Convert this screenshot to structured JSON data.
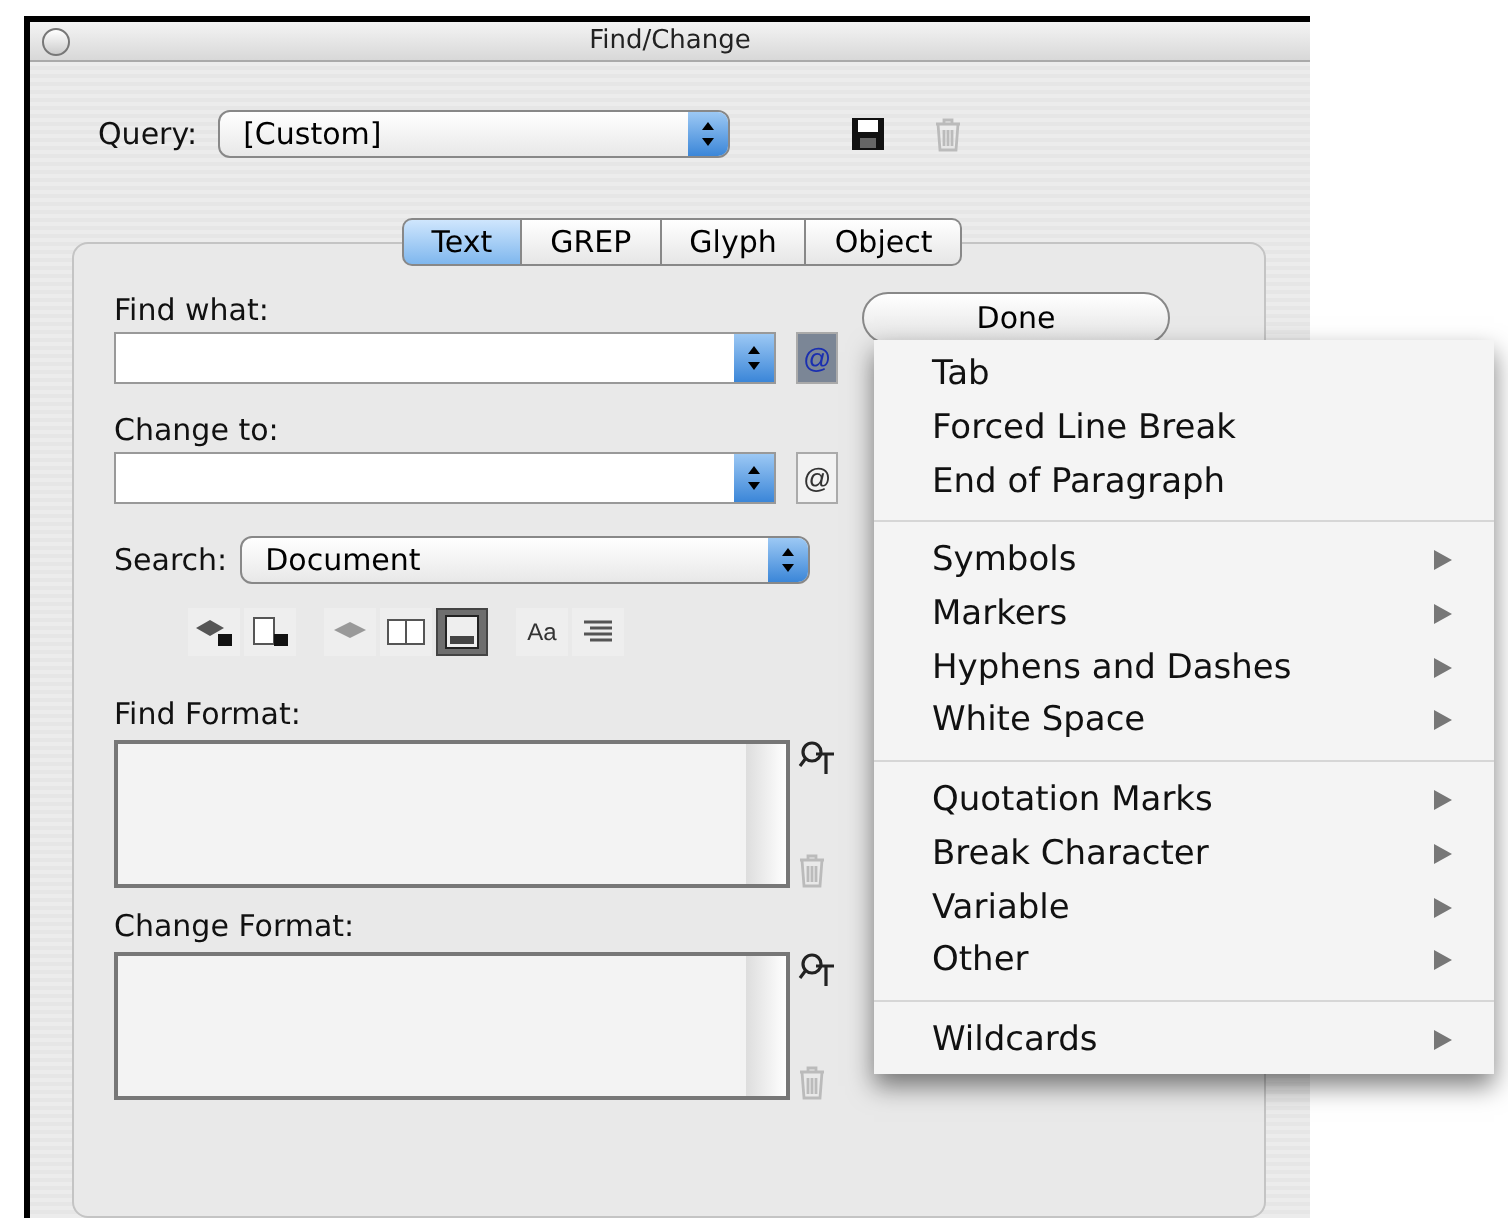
{
  "window": {
    "title": "Find/Change"
  },
  "query": {
    "label": "Query:",
    "value": "[Custom]"
  },
  "tabs": [
    {
      "label": "Text",
      "selected": true
    },
    {
      "label": "GREP",
      "selected": false
    },
    {
      "label": "Glyph",
      "selected": false
    },
    {
      "label": "Object",
      "selected": false
    }
  ],
  "find_what": {
    "label": "Find what:",
    "special_button": "@"
  },
  "change_to": {
    "label": "Change to:",
    "special_button": "@"
  },
  "done_button": "Done",
  "search": {
    "label": "Search:",
    "value": "Document"
  },
  "search_options": [
    {
      "kind": "layers-lock",
      "selected": false
    },
    {
      "kind": "page-lock",
      "selected": false
    },
    {
      "kind": "layers",
      "selected": false
    },
    {
      "kind": "book",
      "selected": false
    },
    {
      "kind": "footnote",
      "selected": true
    },
    {
      "kind": "case",
      "text": "Aa",
      "selected": false
    },
    {
      "kind": "lines",
      "selected": false
    }
  ],
  "find_format": {
    "label": "Find Format:"
  },
  "change_format": {
    "label": "Change Format:"
  },
  "special_menu": {
    "sections": [
      [
        {
          "label": "Tab",
          "submenu": false
        },
        {
          "label": "Forced Line Break",
          "submenu": false
        },
        {
          "label": "End of Paragraph",
          "submenu": false
        }
      ],
      [
        {
          "label": "Symbols",
          "submenu": true
        },
        {
          "label": "Markers",
          "submenu": true
        },
        {
          "label": "Hyphens and Dashes",
          "submenu": true
        },
        {
          "label": "White Space",
          "submenu": true
        }
      ],
      [
        {
          "label": "Quotation Marks",
          "submenu": true
        },
        {
          "label": "Break Character",
          "submenu": true
        },
        {
          "label": "Variable",
          "submenu": true
        },
        {
          "label": "Other",
          "submenu": true
        }
      ],
      [
        {
          "label": "Wildcards",
          "submenu": true
        }
      ]
    ]
  }
}
